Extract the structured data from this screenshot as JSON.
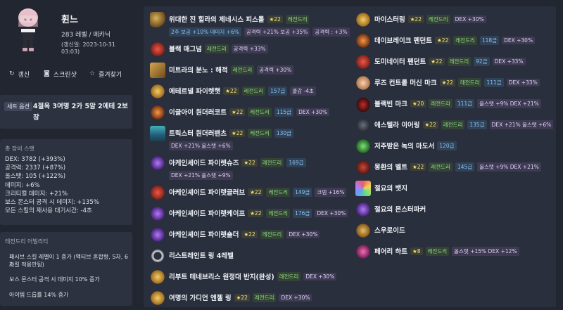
{
  "profile": {
    "name": "휜느",
    "level_class": "283 레벨 / 메카닉",
    "updated": "(갱신일: 2023-10-31 03:03)"
  },
  "actions": {
    "refresh": "갱신",
    "screenshot": "스크린샷",
    "favorite": "즐겨찾기"
  },
  "set_effect": {
    "label": "세트 옵션",
    "text": "4절옥 3여명 2카 5암 2에테 2보장"
  },
  "total_stats": {
    "title": "총 장비 스탯",
    "lines": [
      "DEX: 3782 (+393%)",
      "공격력: 2337 (+87%)",
      "올스탯: 105 (+122%)",
      "데미지: +6%",
      "크리티컬 데미지: +21%",
      "보스 몬스터 공격 시 데미지: +135%",
      "모든 스킬의 재사용 대기시간: -4초"
    ]
  },
  "legendary": {
    "title": "레전드리 어빌리티",
    "options": [
      "패시브 스킬 레벨이 1 증가 (액티브 혼합형, 5차, 6차",
      "스킬 적용안됨)",
      "보스 몬스터 공격 시 데미지 10% 증가",
      "아이템 드롭률 14% 증가"
    ]
  },
  "colors": {
    "background": "#222631",
    "panel": "#2d3240",
    "legendary": "#8fe08c",
    "star": "#f3e27a"
  },
  "items_left": [
    {
      "name": "위대한 진 힐라의 제네시스 피스톨",
      "icon": "pistol-icon",
      "tags": [
        "★22",
        "레전드리"
      ],
      "sub": [
        "2주 보공 +10% 데미지 +6%",
        "공격력 +21% 보공 +35%",
        "공격력 : +3%"
      ]
    },
    {
      "name": "블랙 매그넘",
      "icon": "magnum-icon",
      "tags": [
        "레전드리",
        "공격력 +33%"
      ]
    },
    {
      "name": "미트라의 분노 : 해적",
      "icon": "emblem-icon",
      "tags": [
        "레전드리",
        "공격력 +30%"
      ]
    },
    {
      "name": "에테르넬 파이렛햇",
      "icon": "hat-icon",
      "tags": [
        "★22",
        "레전드리",
        "157급",
        "쿨감 -4초"
      ]
    },
    {
      "name": "이글아이 원더러코트",
      "icon": "coat-icon",
      "tags": [
        "★22",
        "레전드리",
        "115급",
        "DEX +30%"
      ]
    },
    {
      "name": "트릭스터 원더러팬츠",
      "icon": "pants-icon",
      "tags": [
        "★22",
        "레전드리",
        "130급"
      ],
      "sub": [
        "DEX +21% 올스탯 +6%"
      ]
    },
    {
      "name": "아케인셰이드 파이렛슈즈",
      "icon": "shoes-icon",
      "tags": [
        "★22",
        "레전드리",
        "169급"
      ],
      "sub": [
        "DEX +21% 올스탯 +9%"
      ]
    },
    {
      "name": "아케인셰이드 파이렛글러브",
      "icon": "glove-icon",
      "tags": [
        "★22",
        "레전드리",
        "149급",
        "크뎀 +16%"
      ]
    },
    {
      "name": "아케인셰이드 파이렛케이프",
      "icon": "cape-icon",
      "tags": [
        "★22",
        "레전드리",
        "176급",
        "DEX +30%"
      ]
    },
    {
      "name": "아케인셰이드 파이렛숄더",
      "icon": "shoulder-icon",
      "tags": [
        "★22",
        "레전드리",
        "DEX +30%"
      ]
    },
    {
      "name": "리스트레인트 링 4레벨",
      "icon": "ring-icon",
      "tags": []
    },
    {
      "name": "리부트 테네브리스 원정대 반지(완성)",
      "icon": "ring-gold-icon",
      "tags": [
        "레전드리",
        "DEX +30%"
      ]
    },
    {
      "name": "여명의 가디언 엔젤 링",
      "icon": "angel-ring-icon",
      "tags": [
        "★22",
        "레전드리",
        "DEX +30%"
      ]
    }
  ],
  "items_right": [
    {
      "name": "마이스터링",
      "icon": "meister-ring-icon",
      "tags": [
        "★22",
        "레전드리",
        "DEX +30%"
      ]
    },
    {
      "name": "데이브레이크 펜던트",
      "icon": "pendant-icon",
      "tags": [
        "★22",
        "레전드리",
        "118급",
        "DEX +30%"
      ]
    },
    {
      "name": "도미네이터 펜던트",
      "icon": "dominator-icon",
      "tags": [
        "★22",
        "레전드리",
        "92급",
        "DEX +33%"
      ]
    },
    {
      "name": "루즈 컨트롤 머신 마크",
      "icon": "face-icon",
      "tags": [
        "★22",
        "레전드리",
        "111급",
        "DEX +33%"
      ]
    },
    {
      "name": "블랙빈 마크",
      "icon": "blackbean-icon",
      "tags": [
        "★20",
        "레전드리",
        "111급",
        "올스탯 +9% DEX +21%"
      ]
    },
    {
      "name": "에스텔라 이어링",
      "icon": "earring-icon",
      "tags": [
        "★22",
        "레전드리",
        "135급",
        "DEX +21% 올스탯 +6%"
      ]
    },
    {
      "name": "저주받은 녹의 마도서",
      "icon": "grimoire-icon",
      "tags": [
        "120급"
      ]
    },
    {
      "name": "몽환의 벨트",
      "icon": "belt-icon",
      "tags": [
        "★22",
        "레전드리",
        "145급",
        "올스탯 +9% DEX +21%"
      ]
    },
    {
      "name": "절요의 뱃지",
      "icon": "badge-icon",
      "tags": []
    },
    {
      "name": "절요의 몬스터파커",
      "icon": "parka-icon",
      "tags": []
    },
    {
      "name": "스우로이드",
      "icon": "android-icon",
      "tags": []
    },
    {
      "name": "페어리 하트",
      "icon": "heart-icon",
      "tags": [
        "★8",
        "레전드리",
        "올스탯 +15% DEX +12%"
      ]
    }
  ]
}
